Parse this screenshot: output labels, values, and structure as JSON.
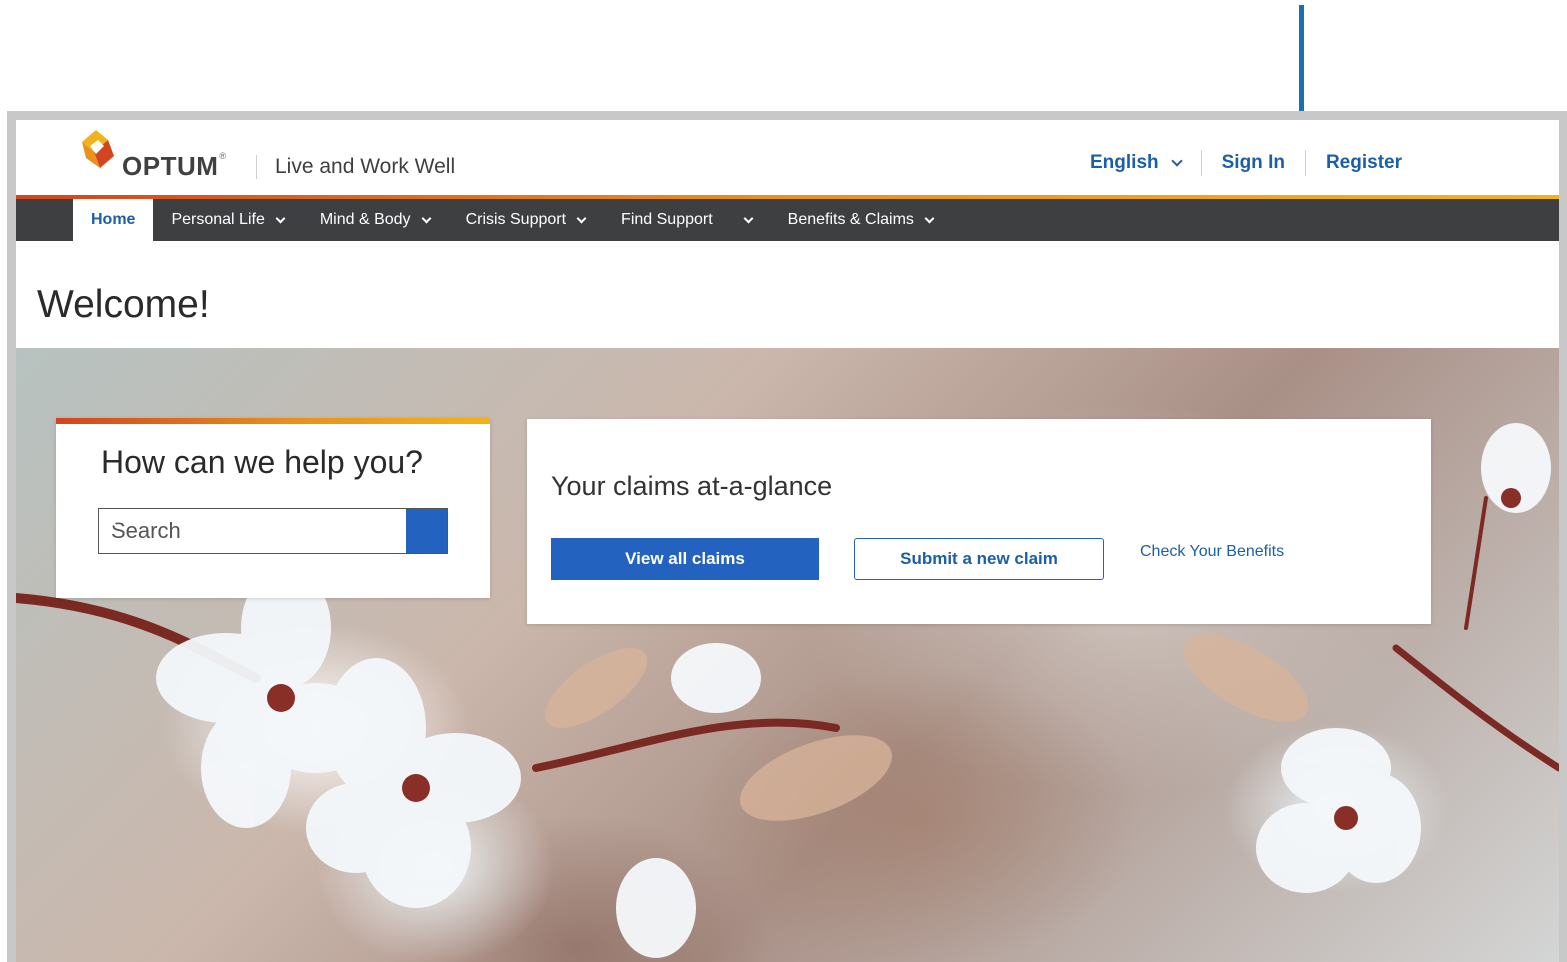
{
  "brand": {
    "name": "OPTUM",
    "reg": "®",
    "tagline": "Live and Work Well"
  },
  "top_links": {
    "language": "English",
    "sign_in": "Sign In",
    "register": "Register"
  },
  "nav": {
    "items": [
      {
        "label": "Home"
      },
      {
        "label": "Personal Life"
      },
      {
        "label": "Mind & Body"
      },
      {
        "label": "Crisis Support"
      },
      {
        "label": "Find Support"
      },
      {
        "label": "Benefits & Claims"
      }
    ]
  },
  "welcome": "Welcome!",
  "search": {
    "title": "How can we help you?",
    "placeholder": "Search"
  },
  "claims": {
    "title": "Your claims at-a-glance",
    "view_all": "View all claims",
    "submit_new": "Submit a new claim",
    "check_benefits": "Check Your Benefits"
  },
  "colors": {
    "brand_blue": "#1b5fa8",
    "button_blue": "#2363bf",
    "nav_bg": "#3d3f41",
    "accent_orange": "#e8911d",
    "annotation_arrow": "#1a6fb3"
  },
  "icons": {
    "annotation": "down-arrow-icon",
    "search": "search-icon",
    "dropdown": "chevron-down-icon"
  }
}
